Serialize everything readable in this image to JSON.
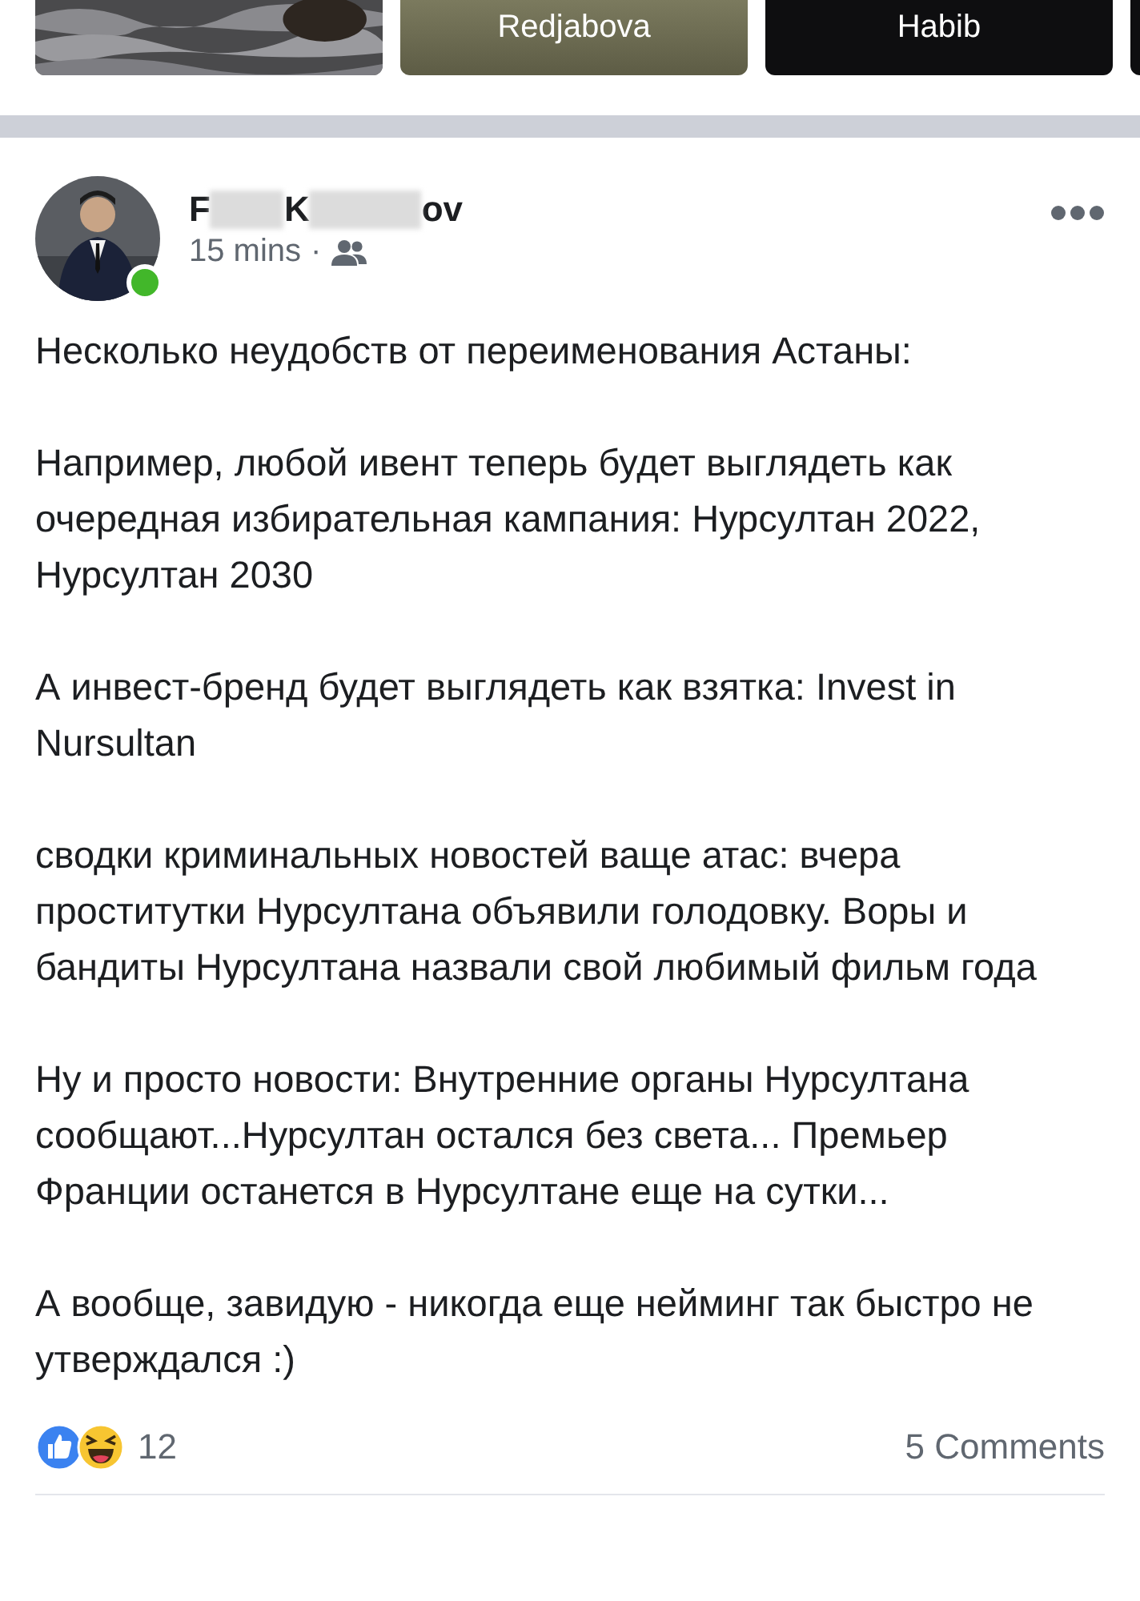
{
  "stories": [
    {
      "kind": "picture"
    },
    {
      "kind": "olive",
      "label": "Redjabova"
    },
    {
      "kind": "dark",
      "label": "Habib"
    },
    {
      "kind": "dark"
    }
  ],
  "post": {
    "author_name_parts": [
      "F",
      "K",
      "ov"
    ],
    "online": true,
    "time": "15 mins",
    "separator": "·",
    "paragraphs": [
      "Несколько неудобств от переименования Астаны:",
      "Например, любой ивент теперь будет выглядеть как очередная избирательная кампания: Нурсултан 2022, Нурсултан 2030",
      "А инвест-бренд будет выглядеть как взятка: Invest in Nursultan",
      "сводки криминальных новостей ваще атас: вчера проститутки Нурсултана объявили голодовку. Воры и бандиты Нурсултана назвали свой любимый фильм года",
      "Ну и просто новости: Внутренние органы Нурсултана сообщают...Нурсултан остался без света... Премьер Франции останется в Нурсултане еще на сутки...",
      "А вообще, завидую - никогда еще нейминг так быстро не утверждался :)"
    ],
    "reaction_count": "12",
    "comments": "5 Comments"
  }
}
